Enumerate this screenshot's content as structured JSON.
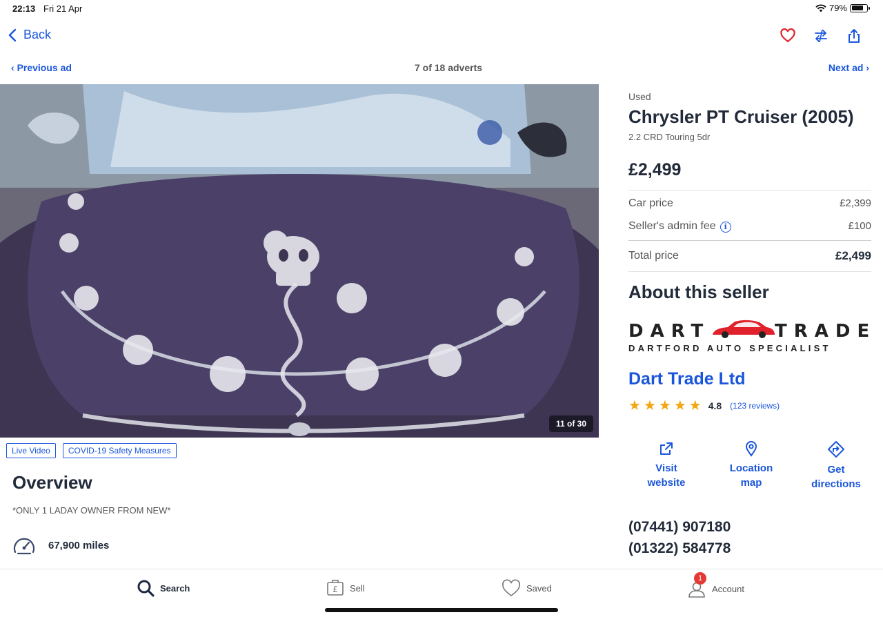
{
  "status_bar": {
    "time": "22:13",
    "date": "Fri 21 Apr",
    "battery": "79%",
    "battery_level": 0.79
  },
  "top_nav": {
    "back_label": "Back"
  },
  "ad_nav": {
    "previous_label": "Previous ad",
    "position": "7 of 18 adverts",
    "next_label": "Next ad"
  },
  "photo": {
    "counter": "11 of 30"
  },
  "tags": [
    "Live Video",
    "COVID-19 Safety Measures"
  ],
  "overview": {
    "title": "Overview",
    "description": "*ONLY 1 LADAY OWNER FROM NEW*",
    "mileage": "67,900 miles"
  },
  "listing": {
    "condition": "Used",
    "title": "Chrysler PT Cruiser (2005)",
    "subtitle": "2.2 CRD Touring 5dr",
    "price": "£2,499"
  },
  "price_breakdown": {
    "car_price_label": "Car price",
    "car_price": "£2,399",
    "admin_fee_label": "Seller's admin fee",
    "admin_fee": "£100",
    "total_label": "Total price",
    "total": "£2,499"
  },
  "seller": {
    "section_title": "About this seller",
    "logo_line1_left": "DART",
    "logo_line1_right": "TRADE",
    "logo_line2": "DARTFORD AUTO SPECIALIST",
    "name": "Dart Trade Ltd",
    "rating": "4.8",
    "rating_value": 4.8,
    "reviews": "(123 reviews)",
    "actions": [
      {
        "line1": "Visit",
        "line2": "website"
      },
      {
        "line1": "Location",
        "line2": "map"
      },
      {
        "line1": "Get",
        "line2": "directions"
      }
    ],
    "phones": [
      "(07441) 907180",
      "(01322) 584778"
    ]
  },
  "tab_bar": {
    "search": "Search",
    "sell": "Sell",
    "saved": "Saved",
    "account": "Account",
    "account_badge": "1"
  },
  "colors": {
    "accent": "#1a56db",
    "heart": "#e0202a",
    "star": "#f3a712",
    "badge": "#e53935"
  }
}
